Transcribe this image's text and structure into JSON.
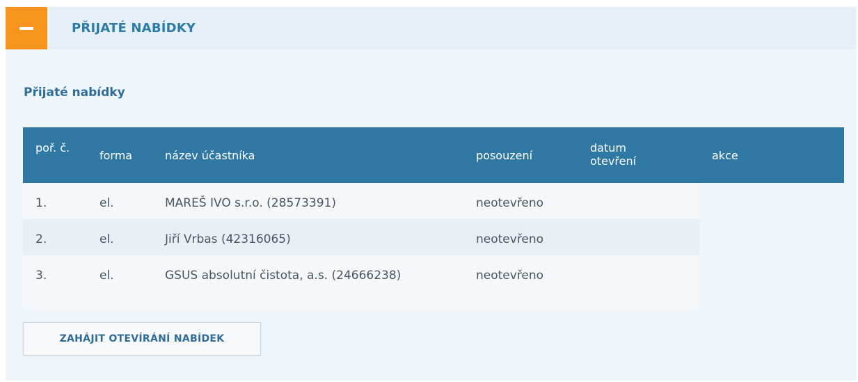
{
  "panel": {
    "title": "PŘIJATÉ NABÍDKY",
    "toggle_symbol": "minus"
  },
  "section": {
    "title": "Přijaté nabídky"
  },
  "table": {
    "headers": {
      "por": "poř. č.",
      "forma": "forma",
      "nazev": "název účastníka",
      "posouzeni": "posouzení",
      "datum": "datum otevření",
      "akce": "akce"
    },
    "rows": [
      {
        "por": "1.",
        "forma": "el.",
        "nazev": "MAREŠ IVO s.r.o. (28573391)",
        "posouzeni": "neotevřeno",
        "datum": ""
      },
      {
        "por": "2.",
        "forma": "el.",
        "nazev": "Jiří Vrbas (42316065)",
        "posouzeni": "neotevřeno",
        "datum": ""
      },
      {
        "por": "3.",
        "forma": "el.",
        "nazev": "GSUS absolutní čistota, a.s. (24666238)",
        "posouzeni": "neotevřeno",
        "datum": ""
      }
    ]
  },
  "actions": {
    "open_bids_label": "ZAHÁJIT OTEVÍRÁNÍ NABÍDEK"
  },
  "colors": {
    "accent_orange": "#f7941d",
    "header_blue": "#2f78a3",
    "title_blue": "#2e7ba6"
  }
}
